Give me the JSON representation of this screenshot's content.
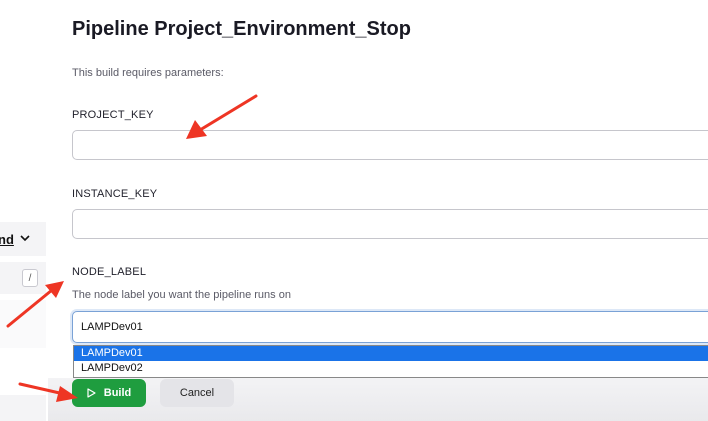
{
  "sidebar": {
    "dropdown_label": "nd",
    "shortcut_key": "/"
  },
  "page": {
    "title": "Pipeline Project_Environment_Stop",
    "subtitle": "This build requires parameters:"
  },
  "params": [
    {
      "name": "PROJECT_KEY",
      "value": ""
    },
    {
      "name": "INSTANCE_KEY",
      "value": ""
    },
    {
      "name": "NODE_LABEL",
      "description": "The node label you want the pipeline runs on",
      "selected": "LAMPDev01",
      "options": [
        "LAMPDev01",
        "LAMPDev02"
      ]
    }
  ],
  "actions": {
    "build_label": "Build",
    "cancel_label": "Cancel"
  },
  "colors": {
    "annotation_arrow": "#ee3524",
    "build_button": "#1f9d3f",
    "option_highlight": "#1a73e8"
  }
}
